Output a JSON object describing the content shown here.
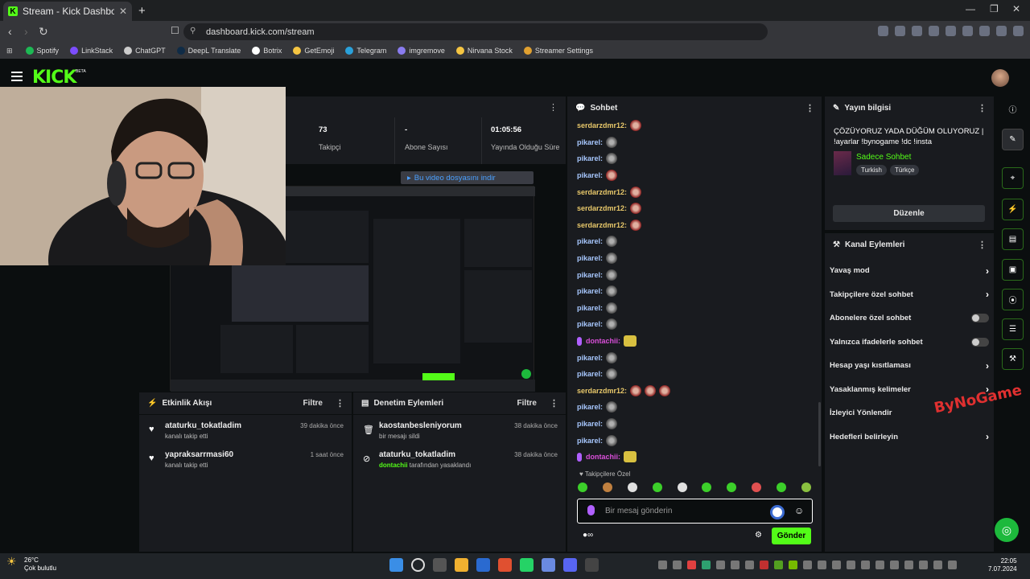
{
  "browser": {
    "tab_title": "Stream - Kick Dashboard",
    "url": "dashboard.kick.com/stream",
    "bookmarks": [
      {
        "label": "Spotify",
        "color": "#1db954"
      },
      {
        "label": "LinkStack",
        "color": "#7c4dff"
      },
      {
        "label": "ChatGPT",
        "color": "#cccccc"
      },
      {
        "label": "DeepL Translate",
        "color": "#0f2b46"
      },
      {
        "label": "Botrix",
        "color": "#ffffff"
      },
      {
        "label": "GetEmoji",
        "color": "#f5c542"
      },
      {
        "label": "Telegram",
        "color": "#2aa1da"
      },
      {
        "label": "imgremove",
        "color": "#8a7cf0"
      },
      {
        "label": "Nirvana Stock",
        "color": "#f5c542"
      },
      {
        "label": "Streamer Settings",
        "color": "#e0a030"
      }
    ]
  },
  "brand": {
    "logo": "KICK",
    "beta": "BETA",
    "accent": "#53fc18"
  },
  "stats": [
    {
      "value": "73",
      "label": "Takipçi"
    },
    {
      "value": "-",
      "label": "Abone Sayısı"
    },
    {
      "value": "01:05:56",
      "label": "Yayında Olduğu Süre"
    }
  ],
  "video": {
    "download_label": "Bu video dosyasını indir"
  },
  "activity": {
    "title": "Etkinlik Akışı",
    "filter": "Filtre",
    "items": [
      {
        "user": "ataturku_tokatladim",
        "sub": "kanalı takip etti",
        "time": "39 dakika önce"
      },
      {
        "user": "yapraksarrmasi60",
        "sub": "kanalı takip etti",
        "time": "1 saat önce"
      }
    ]
  },
  "moderation": {
    "title": "Denetim Eylemleri",
    "filter": "Filtre",
    "items": [
      {
        "user": "kaostanbesleniyorum",
        "sub": "bir mesajı sildi",
        "time": "38 dakika önce"
      },
      {
        "user": "ataturku_tokatladim",
        "sub_user": "dontachii",
        "sub": "tarafından yasaklandı",
        "time": "38 dakika önce"
      }
    ]
  },
  "chat": {
    "title": "Sohbet",
    "messages": [
      {
        "user": "serdarzdmr12:",
        "color": "#e8c86a",
        "emote": "r"
      },
      {
        "user": "pikarel:",
        "color": "#a8c8ff",
        "emote": "p"
      },
      {
        "user": "pikarel:",
        "color": "#a8c8ff",
        "emote": "p"
      },
      {
        "user": "pikarel:",
        "color": "#a8c8ff",
        "emote": "r"
      },
      {
        "user": "serdarzdmr12:",
        "color": "#e8c86a",
        "emote": "r"
      },
      {
        "user": "serdarzdmr12:",
        "color": "#e8c86a",
        "emote": "r"
      },
      {
        "user": "serdarzdmr12:",
        "color": "#e8c86a",
        "emote": "r"
      },
      {
        "user": "pikarel:",
        "color": "#a8c8ff",
        "emote": "p"
      },
      {
        "user": "pikarel:",
        "color": "#a8c8ff",
        "emote": "p"
      },
      {
        "user": "pikarel:",
        "color": "#a8c8ff",
        "emote": "p"
      },
      {
        "user": "pikarel:",
        "color": "#a8c8ff",
        "emote": "p"
      },
      {
        "user": "pikarel:",
        "color": "#a8c8ff",
        "emote": "p"
      },
      {
        "user": "pikarel:",
        "color": "#a8c8ff",
        "emote": "p"
      },
      {
        "user": "dontachii:",
        "color": "#d94fd9",
        "emote": "g"
      },
      {
        "user": "pikarel:",
        "color": "#a8c8ff",
        "emote": "p"
      },
      {
        "user": "pikarel:",
        "color": "#a8c8ff",
        "emote": "p"
      },
      {
        "user": "serdarzdmr12:",
        "color": "#e8c86a",
        "emote": "r"
      },
      {
        "user": "pikarel:",
        "color": "#a8c8ff",
        "emote": "p"
      },
      {
        "user": "pikarel:",
        "color": "#a8c8ff",
        "emote": "p"
      },
      {
        "user": "pikarel:",
        "color": "#a8c8ff",
        "emote": "p"
      },
      {
        "user": "dontachii:",
        "color": "#d94fd9",
        "emote": "g"
      }
    ],
    "mode_label": "Takipçilere Özel",
    "input_placeholder": "Bir mesaj gönderin",
    "send_label": "Gönder"
  },
  "stream_info": {
    "title": "Yayın bilgisi",
    "stream_title": "ÇÖZÜYORUZ YADA DÜĞÜM OLUYORUZ | !ayarlar !bynogame !dc !insta",
    "category": "Sadece Sohbet",
    "tags": [
      "Turkish",
      "Türkçe"
    ],
    "edit_label": "Düzenle"
  },
  "channel_actions": {
    "title": "Kanal Eylemleri",
    "items": [
      {
        "label": "Yavaş mod",
        "kind": "chevron"
      },
      {
        "label": "Takipçilere özel sohbet",
        "kind": "chevron"
      },
      {
        "label": "Abonelere özel sohbet",
        "kind": "toggle"
      },
      {
        "label": "Yalnızca ifadelerle sohbet",
        "kind": "toggle"
      },
      {
        "label": "Hesap yaşı kısıtlaması",
        "kind": "chevron"
      },
      {
        "label": "Yasaklanmış kelimeler",
        "kind": "chevron"
      },
      {
        "label": "İzleyici Yönlendir",
        "kind": "none"
      },
      {
        "label": "Hedefleri belirleyin",
        "kind": "chevron"
      }
    ]
  },
  "taskbar": {
    "temp": "26°C",
    "weather": "Çok bulutlu",
    "time": "22:05",
    "date": "7.07.2024"
  }
}
